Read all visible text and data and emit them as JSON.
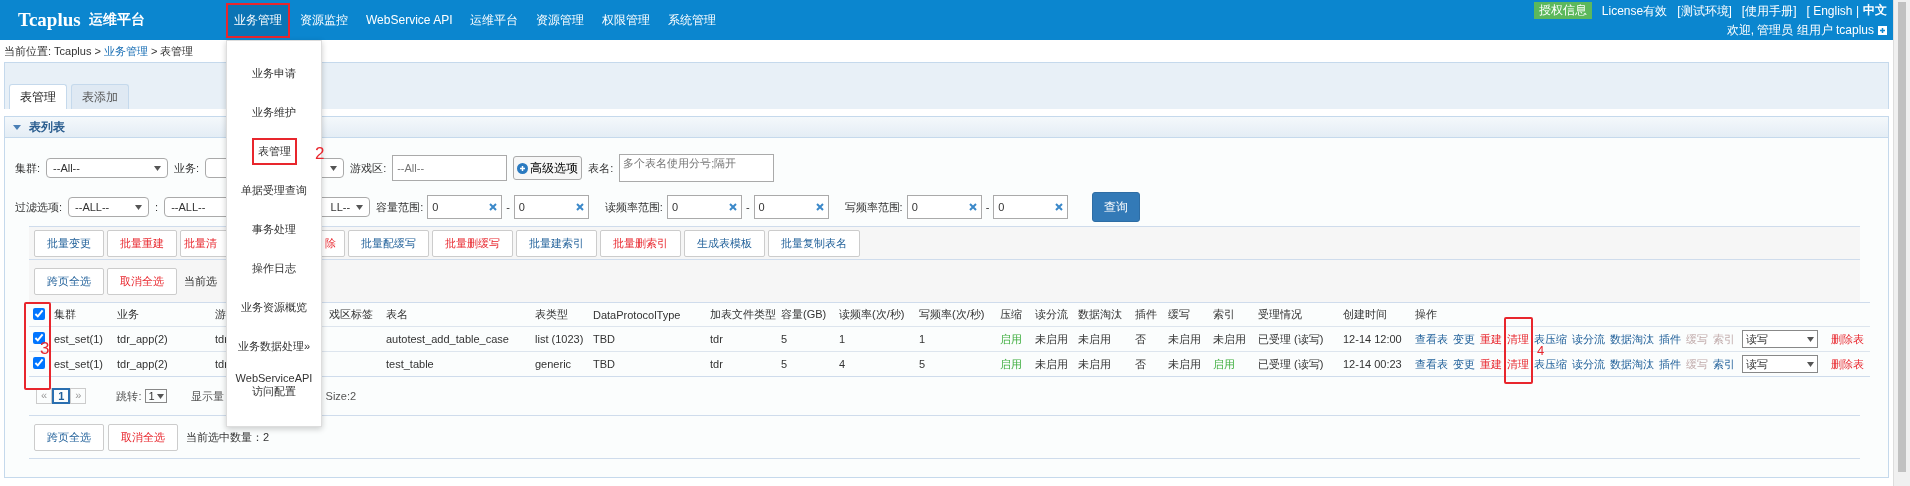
{
  "header": {
    "logo": "Tcaplus",
    "logo_sub": "运维平台",
    "nav": [
      {
        "label": "业务管理",
        "selected": true,
        "highlighted": true
      },
      {
        "label": "资源监控",
        "selected": false,
        "highlighted": false
      },
      {
        "label": "WebService API",
        "selected": false,
        "highlighted": false
      },
      {
        "label": "运维平台",
        "selected": false,
        "highlighted": false
      },
      {
        "label": "资源管理",
        "selected": false,
        "highlighted": false
      },
      {
        "label": "权限管理",
        "selected": false,
        "highlighted": false
      },
      {
        "label": "系统管理",
        "selected": false,
        "highlighted": false
      }
    ],
    "badge": "授权信息",
    "links": [
      "License有效",
      "[测试环境]",
      "[使用手册]",
      "[ English |"
    ],
    "lang_current": "中文",
    "welcome": "欢迎, 管理员 组用户 tcaplus"
  },
  "breadcrumb": [
    {
      "text": "当前位置: Tcaplus >",
      "kind": "plain"
    },
    {
      "text": "业务管理",
      "kind": "link"
    },
    {
      "text": "> 表管理",
      "kind": "plain"
    }
  ],
  "tabs": [
    {
      "label": "表管理",
      "selected": true
    },
    {
      "label": "表添加",
      "selected": false
    }
  ],
  "panel": {
    "title": "表列表",
    "expanded": true
  },
  "filters_row1": [
    {
      "kind": "select",
      "label": "集群:",
      "value": "--All--"
    },
    {
      "kind": "select",
      "label": "业务:"
    },
    {
      "kind": "input",
      "label": "游戏区:",
      "placeholder": "--All--"
    },
    {
      "kind": "button",
      "label": "高级选项"
    },
    {
      "kind": "textarea",
      "label": "表名:",
      "placeholder": "多个表名使用分号;隔开"
    }
  ],
  "filters_row2": [
    {
      "kind": "select",
      "label": "过滤选项:",
      "value": "--ALL--"
    },
    {
      "kind": "select",
      "label": ":",
      "value": "--ALL--"
    },
    {
      "kind": "select",
      "value": "LL--"
    },
    {
      "kind": "range",
      "label": "容量范围:",
      "from": "0",
      "to": "0",
      "separator": "-"
    },
    {
      "kind": "range",
      "label": "读频率范围:",
      "from": "0",
      "to": "0",
      "separator": "-"
    },
    {
      "kind": "range",
      "label": "写频率范围:",
      "from": "0",
      "to": "0",
      "separator": "-"
    },
    {
      "kind": "submit",
      "label": "查询"
    }
  ],
  "batch_buttons": [
    {
      "label": "批量变更",
      "danger": false,
      "kind": "full"
    },
    {
      "label": "批量重建",
      "danger": true,
      "kind": "full"
    },
    {
      "label": "批量清",
      "danger": true,
      "kind": "cut_right"
    },
    {
      "label": "除",
      "danger": true,
      "kind": "cut_left"
    },
    {
      "label": "批量配缓写",
      "danger": false,
      "kind": "full"
    },
    {
      "label": "批量删缓写",
      "danger": true,
      "kind": "full"
    },
    {
      "label": "批量建索引",
      "danger": false,
      "kind": "full"
    },
    {
      "label": "批量删索引",
      "danger": true,
      "kind": "full"
    },
    {
      "label": "生成表模板",
      "danger": false,
      "kind": "full"
    },
    {
      "label": "批量复制表名",
      "danger": false,
      "kind": "full"
    }
  ],
  "selection_top": {
    "buttons": [
      {
        "label": "跨页全选",
        "danger": false
      },
      {
        "label": "取消全选",
        "danger": true
      }
    ],
    "count_text": "当前选"
  },
  "table": {
    "all_checked": true,
    "columns": [
      "集群",
      "业务",
      "游",
      "戏区标签",
      "表名",
      "表类型",
      "DataProtocolType",
      "加表文件类型",
      "容量(GB)",
      "读频率(次/秒)",
      "写频率(次/秒)",
      "压缩",
      "读分流",
      "数据淘汰",
      "插件",
      "缓写",
      "索引",
      "受理情况",
      "创建时间",
      "操作"
    ],
    "rows": [
      {
        "checked": true,
        "cells": [
          {
            "kind": "text",
            "text": "est_set(1)"
          },
          {
            "kind": "text",
            "text": "tdr_app(2)"
          },
          {
            "kind": "text",
            "text": "tdr"
          },
          {
            "kind": "blank"
          },
          {
            "kind": "text",
            "text": "autotest_add_table_case"
          },
          {
            "kind": "text",
            "text": "list (1023)"
          },
          {
            "kind": "text",
            "text": "TBD"
          },
          {
            "kind": "text",
            "text": "tdr"
          },
          {
            "kind": "text",
            "text": "5"
          },
          {
            "kind": "text",
            "text": "1"
          },
          {
            "kind": "text",
            "text": "1"
          },
          {
            "kind": "status",
            "text": "启用",
            "on": true
          },
          {
            "kind": "status",
            "text": "未启用",
            "on": false
          },
          {
            "kind": "status",
            "text": "未启用",
            "on": false
          },
          {
            "kind": "text",
            "text": "否"
          },
          {
            "kind": "status",
            "text": "未启用",
            "on": false
          },
          {
            "kind": "status",
            "text": "未启用",
            "on": false
          },
          {
            "kind": "text",
            "text": "已受理 (读写)"
          },
          {
            "kind": "text",
            "text": "12-14 12:00"
          }
        ],
        "ops": [
          {
            "kind": "link",
            "label": "查看表",
            "disabled": false
          },
          {
            "kind": "link",
            "label": "变更",
            "disabled": false
          },
          {
            "kind": "danger",
            "label": "重建",
            "disabled": false
          },
          {
            "kind": "danger",
            "label": "清理",
            "disabled": false
          },
          {
            "kind": "link",
            "label": "表压缩",
            "disabled": false
          },
          {
            "kind": "link",
            "label": "读分流",
            "disabled": false
          },
          {
            "kind": "link",
            "label": "数据淘汰",
            "disabled": false
          },
          {
            "kind": "link",
            "label": "插件",
            "disabled": false
          },
          {
            "kind": "link",
            "label": "缓写",
            "disabled": true
          },
          {
            "kind": "link",
            "label": "索引",
            "disabled": true
          },
          {
            "kind": "select",
            "label": "读写",
            "disabled": false
          },
          {
            "kind": "danger",
            "label": "删除表",
            "disabled": false
          }
        ]
      },
      {
        "checked": true,
        "cells": [
          {
            "kind": "text",
            "text": "est_set(1)"
          },
          {
            "kind": "text",
            "text": "tdr_app(2)"
          },
          {
            "kind": "text",
            "text": "tdr"
          },
          {
            "kind": "blank"
          },
          {
            "kind": "text",
            "text": "test_table"
          },
          {
            "kind": "text",
            "text": "generic"
          },
          {
            "kind": "text",
            "text": "TBD"
          },
          {
            "kind": "text",
            "text": "tdr"
          },
          {
            "kind": "text",
            "text": "5"
          },
          {
            "kind": "text",
            "text": "4"
          },
          {
            "kind": "text",
            "text": "5"
          },
          {
            "kind": "status",
            "text": "启用",
            "on": true
          },
          {
            "kind": "status",
            "text": "未启用",
            "on": false
          },
          {
            "kind": "status",
            "text": "未启用",
            "on": false
          },
          {
            "kind": "text",
            "text": "否"
          },
          {
            "kind": "status",
            "text": "未启用",
            "on": false
          },
          {
            "kind": "status",
            "text": "启用",
            "on": true
          },
          {
            "kind": "text",
            "text": "已受理 (读写)"
          },
          {
            "kind": "text",
            "text": "12-14 00:23"
          }
        ],
        "ops": [
          {
            "kind": "link",
            "label": "查看表",
            "disabled": false
          },
          {
            "kind": "link",
            "label": "变更",
            "disabled": false
          },
          {
            "kind": "danger",
            "label": "重建",
            "disabled": false
          },
          {
            "kind": "danger",
            "label": "清理",
            "disabled": false
          },
          {
            "kind": "link",
            "label": "表压缩",
            "disabled": false
          },
          {
            "kind": "link",
            "label": "读分流",
            "disabled": false
          },
          {
            "kind": "link",
            "label": "数据淘汰",
            "disabled": false
          },
          {
            "kind": "link",
            "label": "插件",
            "disabled": false
          },
          {
            "kind": "link",
            "label": "缓写",
            "disabled": true
          },
          {
            "kind": "link",
            "label": "索引",
            "disabled": false
          },
          {
            "kind": "select",
            "label": "读写",
            "disabled": false
          },
          {
            "kind": "danger",
            "label": "删除表",
            "disabled": false
          }
        ]
      }
    ]
  },
  "pagination": {
    "prev": "«",
    "current": "1",
    "next": "»",
    "jump_label": "跳转:",
    "jump_value": "1",
    "info_left": "显示量",
    "info_right": "Size:2"
  },
  "selection_bottom": {
    "buttons": [
      {
        "label": "跨页全选",
        "danger": false
      },
      {
        "label": "取消全选",
        "danger": true
      }
    ],
    "count_text": "当前选中数量：2"
  },
  "menu": {
    "items": [
      {
        "label": "业务申请",
        "highlighted": false
      },
      {
        "label": "业务维护",
        "highlighted": false
      },
      {
        "label": "表管理",
        "highlighted": true,
        "note": "2"
      },
      {
        "label": "单据受理查询",
        "highlighted": false
      },
      {
        "label": "事务处理",
        "highlighted": false
      },
      {
        "label": "操作日志",
        "highlighted": false
      },
      {
        "label": "业务资源概览",
        "highlighted": false
      },
      {
        "label": "业务数据处理»",
        "highlighted": false
      },
      {
        "label": "WebServiceAPI 访问配置",
        "highlighted": false
      }
    ]
  },
  "annotations": [
    {
      "note": "3"
    },
    {
      "note": "4"
    }
  ]
}
